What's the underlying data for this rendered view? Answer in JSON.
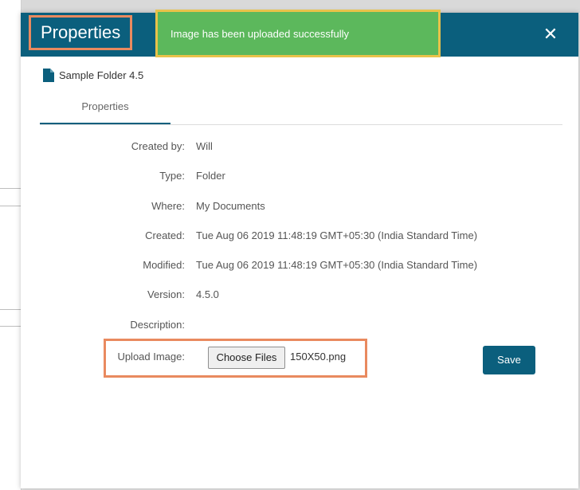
{
  "dialog": {
    "title": "Properties",
    "close_glyph": "✕",
    "folder_name": "Sample Folder 4.5",
    "tab_label": "Properties"
  },
  "toast": {
    "message": "Image has been uploaded successfully",
    "color": "#5cb85c"
  },
  "properties": [
    {
      "label": "Created by:",
      "value": "Will"
    },
    {
      "label": "Type:",
      "value": "Folder"
    },
    {
      "label": "Where:",
      "value": "My Documents"
    },
    {
      "label": "Created:",
      "value": "Tue Aug 06 2019 11:48:19 GMT+05:30 (India Standard Time)"
    },
    {
      "label": "Modified:",
      "value": "Tue Aug 06 2019 11:48:19 GMT+05:30 (India Standard Time)"
    },
    {
      "label": "Version:",
      "value": "4.5.0"
    },
    {
      "label": "Description:",
      "value": ""
    }
  ],
  "upload": {
    "label": "Upload Image:",
    "button_label": "Choose Files",
    "file_name": "150X50.png"
  },
  "save_label": "Save",
  "colors": {
    "header": "#0b5f7d",
    "highlight": "#e98a5f",
    "toast_border": "#e8c24a"
  },
  "icons": {
    "folder": "document-icon",
    "close": "close-icon"
  }
}
